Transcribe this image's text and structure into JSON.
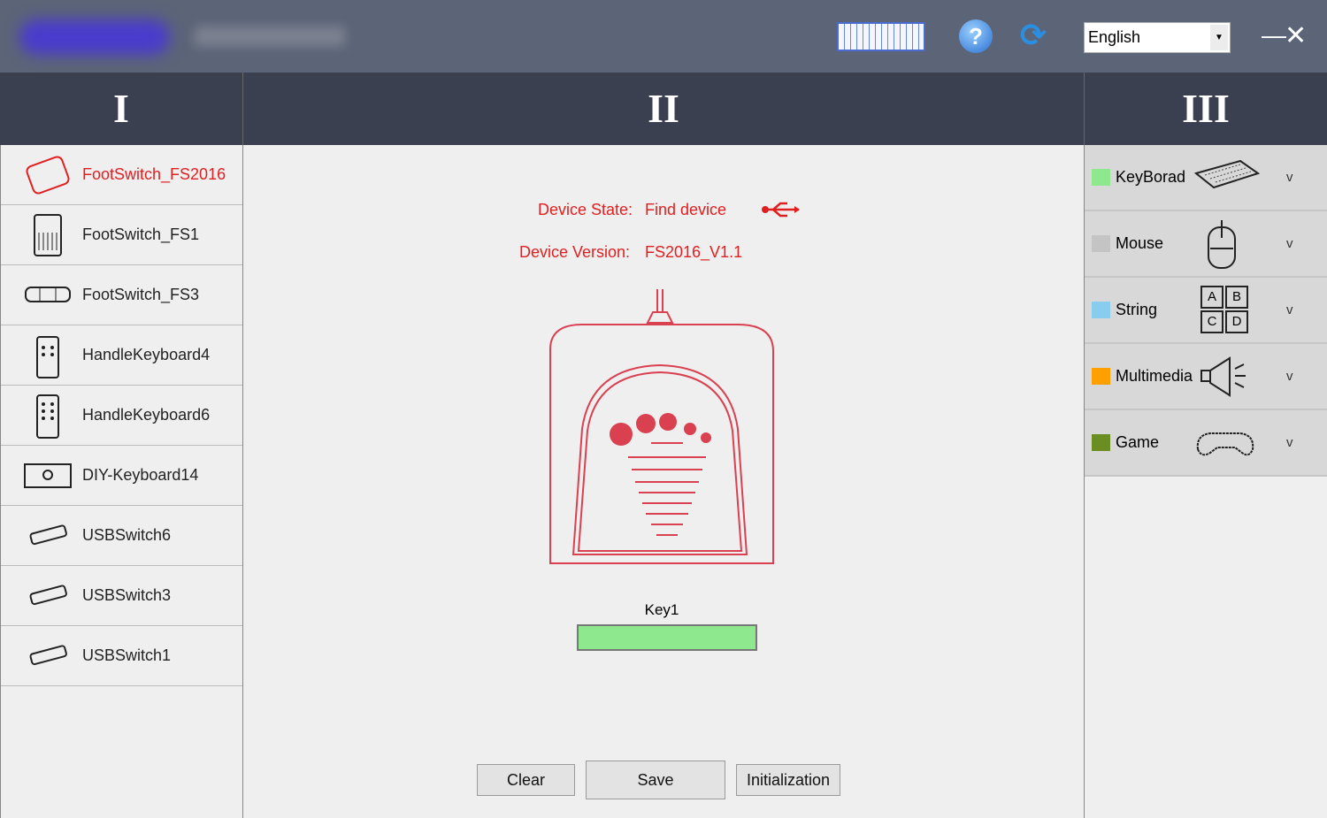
{
  "titlebar": {
    "language": "English",
    "icons": [
      "keyboard-layout-icon",
      "help-icon",
      "refresh-icon"
    ],
    "minimize": "—",
    "close": "✕"
  },
  "columns": [
    "I",
    "II",
    "III"
  ],
  "devices": [
    {
      "label": "FootSwitch_FS2016",
      "active": true
    },
    {
      "label": "FootSwitch_FS1"
    },
    {
      "label": "FootSwitch_FS3"
    },
    {
      "label": "HandleKeyboard4"
    },
    {
      "label": "HandleKeyboard6"
    },
    {
      "label": "DIY-Keyboard14"
    },
    {
      "label": "USBSwitch6"
    },
    {
      "label": "USBSwitch3"
    },
    {
      "label": "USBSwitch1"
    }
  ],
  "device_info": {
    "state_label": "Device State:",
    "state_value": "Find device",
    "version_label": "Device Version:",
    "version_value": "FS2016_V1.1"
  },
  "key": {
    "label": "Key1",
    "color": "#8ee88e"
  },
  "buttons": {
    "clear": "Clear",
    "save": "Save",
    "init": "Initialization"
  },
  "categories": [
    {
      "label": "KeyBorad",
      "color": "#8ee88e",
      "chev": "v"
    },
    {
      "label": "Mouse",
      "color": "#c4c4c4",
      "chev": "v"
    },
    {
      "label": "String",
      "color": "#88ccee",
      "chev": "v",
      "keys": [
        "A",
        "B",
        "C",
        "D"
      ]
    },
    {
      "label": "Multimedia",
      "color": "#ffa000",
      "chev": "v"
    },
    {
      "label": "Game",
      "color": "#6b8e23",
      "chev": "v"
    }
  ]
}
